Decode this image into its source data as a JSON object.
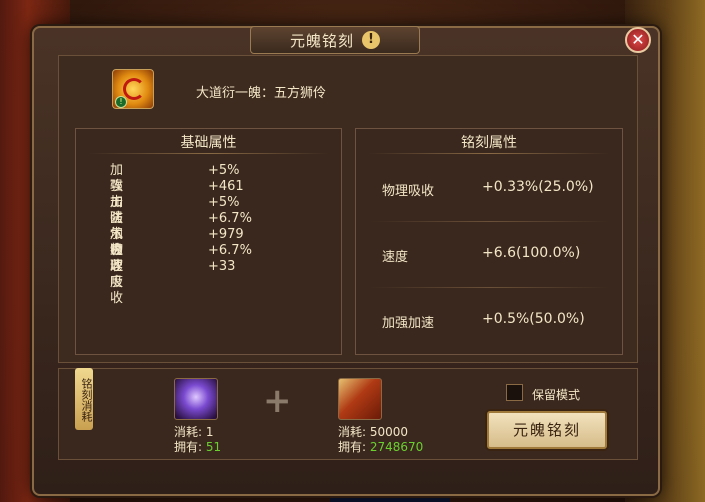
{
  "dialog": {
    "title": "元魄铭刻",
    "warn_icon": "!",
    "close_icon": "✕"
  },
  "item": {
    "name": "大道衍一魄：五方狮伶",
    "icon": "gold-soul-orb-icon"
  },
  "base_attributes": {
    "header": "基础属性",
    "rows": [
      {
        "name": "加强加防",
        "value": "+5%"
      },
      {
        "name": "攻击",
        "value": "+461"
      },
      {
        "name": "加强加速",
        "value": "+5%"
      },
      {
        "name": "法术吸收",
        "value": "+6.7%"
      },
      {
        "name": "气血",
        "value": "+979"
      },
      {
        "name": "物理吸收",
        "value": "+6.7%"
      },
      {
        "name": "速度",
        "value": "+33"
      }
    ]
  },
  "engrave_attributes": {
    "header": "铭刻属性",
    "rows": [
      {
        "name": "物理吸收",
        "value": "+0.33%(25.0%)"
      },
      {
        "name": "速度",
        "value": "+6.6(100.0%)"
      },
      {
        "name": "加强加速",
        "value": "+0.5%(50.0%)"
      }
    ]
  },
  "cost": {
    "side_tag": "铭刻消耗",
    "material1": {
      "consume_label": "消耗:",
      "consume_value": "1",
      "own_label": "拥有:",
      "own_value": "51"
    },
    "material2": {
      "consume_label": "消耗:",
      "consume_value": "50000",
      "own_label": "拥有:",
      "own_value": "2748670"
    },
    "plus": "+"
  },
  "keep_mode": {
    "label": "保留模式",
    "checked": false
  },
  "engrave_button": "元魄铭刻"
}
